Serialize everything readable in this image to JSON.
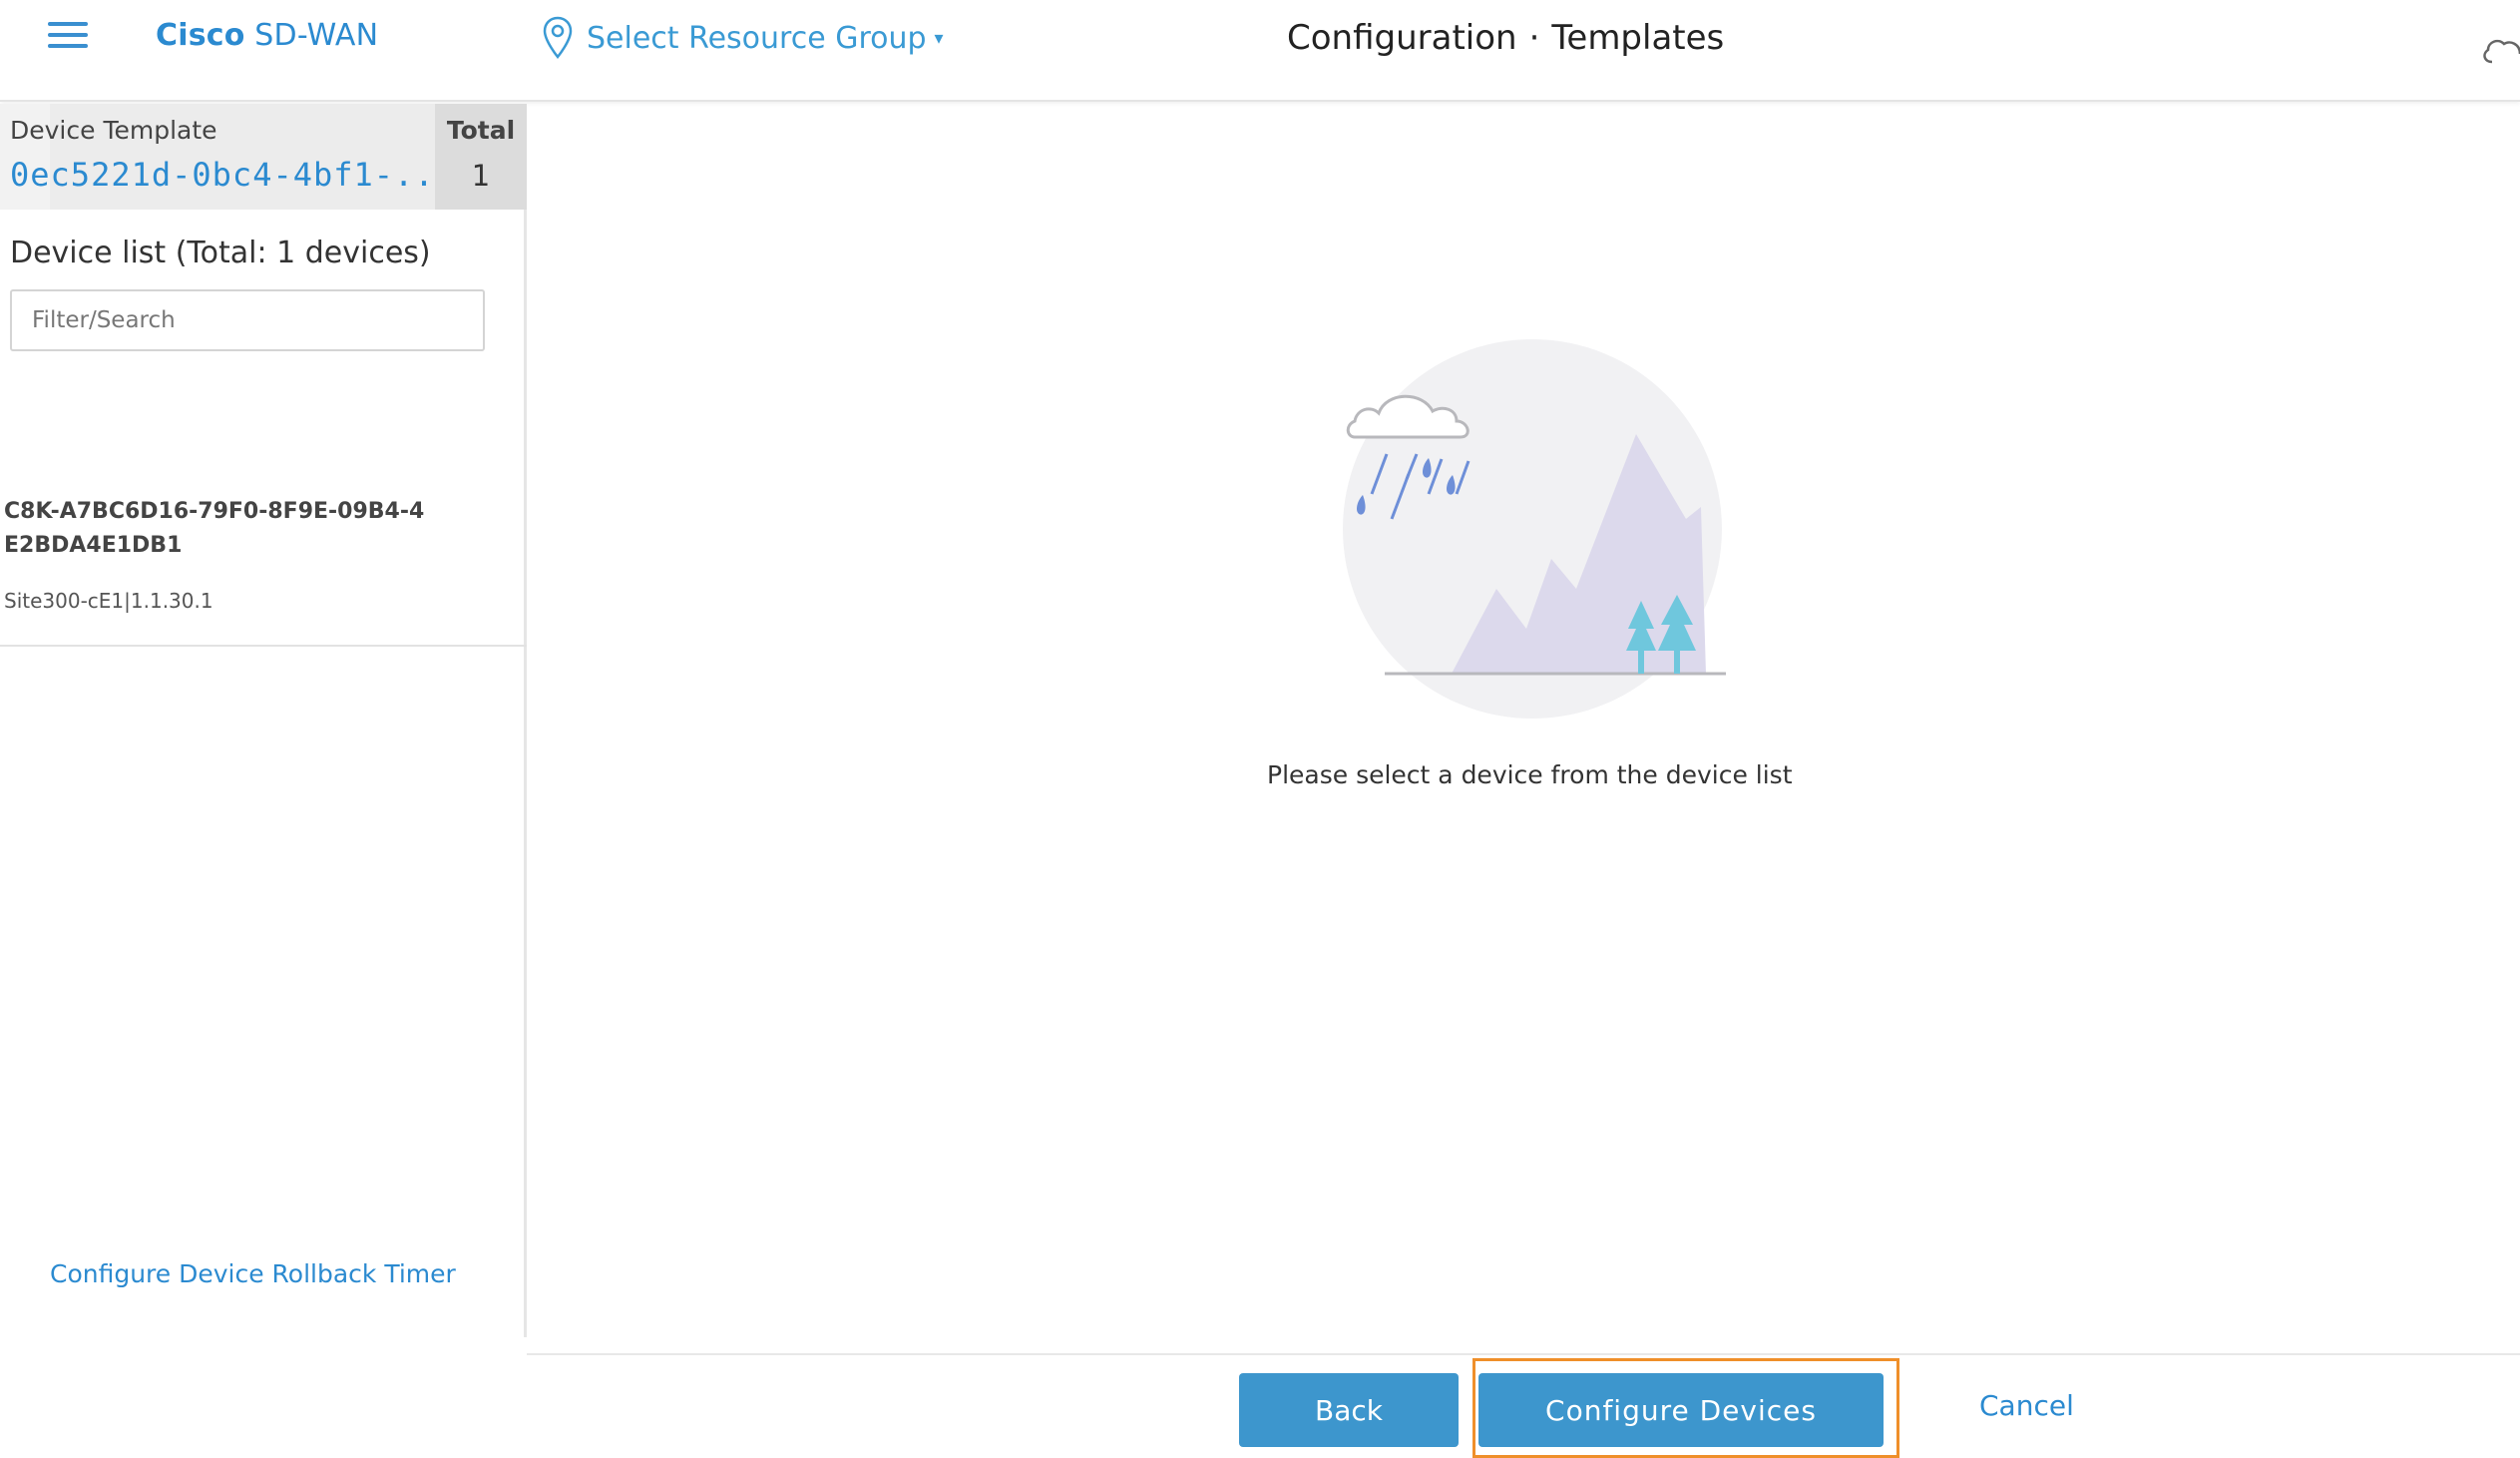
{
  "header": {
    "brand_bold": "Cisco",
    "brand_rest": " SD-WAN",
    "resource_group_label": "Select Resource Group",
    "resource_group_caret": "▾",
    "title_part1": "Configuration",
    "title_sep": "·",
    "title_part2": "Templates"
  },
  "left_panel": {
    "template_label": "Device Template",
    "template_value": "0ec5221d-0bc4-4bf1-...",
    "total_label": "Total",
    "total_value": "1",
    "device_list_title": "Device list (Total: 1 devices)",
    "filter_placeholder": "Filter/Search",
    "devices": [
      {
        "name": "C8K-A7BC6D16-79F0-8F9E-09B4-4E2BDA4E1DB1",
        "subtitle": "Site300-cE1|1.1.30.1"
      }
    ],
    "rollback_link": "Configure Device Rollback Timer"
  },
  "main": {
    "empty_message": "Please select a device from the device list"
  },
  "footer": {
    "back_label": "Back",
    "configure_label": "Configure Devices",
    "cancel_label": "Cancel"
  },
  "colors": {
    "accent": "#2b8ad0",
    "button": "#3d96cd",
    "highlight": "#ef8f2a"
  }
}
